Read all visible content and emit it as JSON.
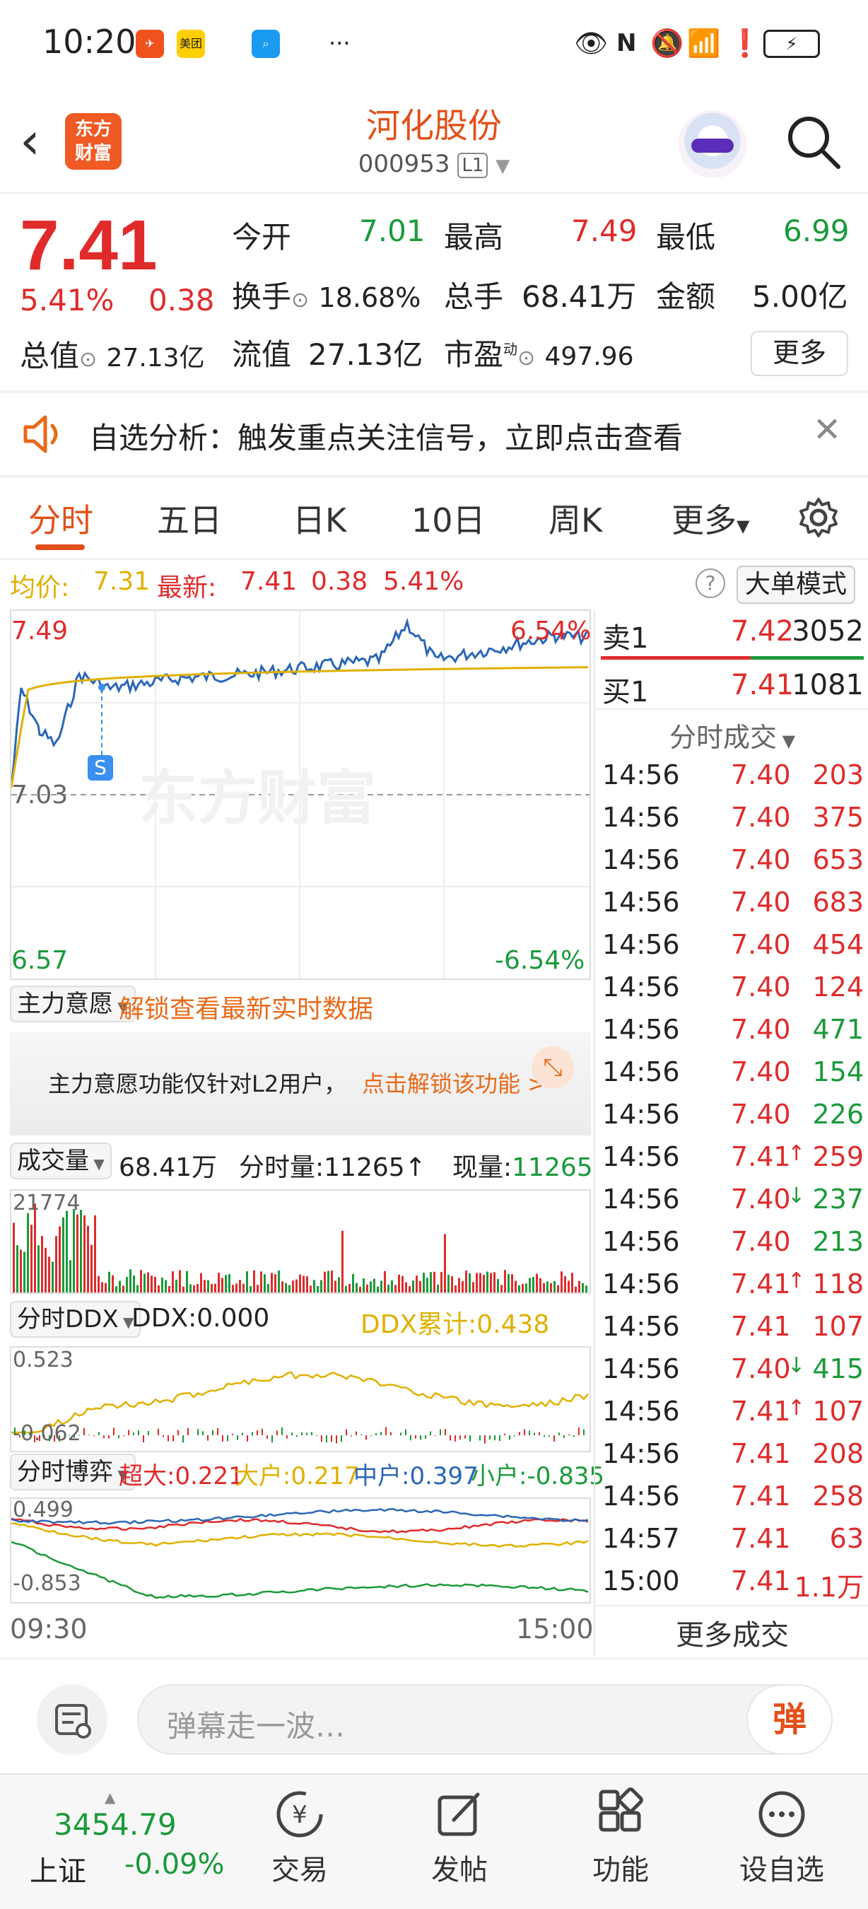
{
  "status_bar": {
    "time": "10:20",
    "app1": "",
    "app2": "美团",
    "dots": "···"
  },
  "header": {
    "logo_text": "东方\n财富",
    "stock_name": "河化股份",
    "stock_code": "000953",
    "level_badge": "L1"
  },
  "quote": {
    "price": "7.41",
    "change_pct": "5.41%",
    "change": "0.38",
    "open_label": "今开",
    "open": "7.01",
    "high_label": "最高",
    "high": "7.49",
    "low_label": "最低",
    "low": "6.99",
    "turnover_label": "换手",
    "turnover": "18.68%",
    "volume_label": "总手",
    "volume": "68.41万",
    "amount_label": "金额",
    "amount": "5.00亿",
    "mktcap_label": "总值",
    "mktcap": "27.13亿",
    "float_label": "流值",
    "float": "27.13亿",
    "pe_label": "市盈",
    "pe_sup": "动",
    "pe": "497.96",
    "more": "更多"
  },
  "notice": {
    "text": "自选分析：触发重点关注信号，立即点击查看"
  },
  "tabs": [
    {
      "label": "分时"
    },
    {
      "label": "五日"
    },
    {
      "label": "日K"
    },
    {
      "label": "10日"
    },
    {
      "label": "周K"
    },
    {
      "label": "更多"
    }
  ],
  "info_row": {
    "avg_label": "均价:",
    "avg": "7.31",
    "latest_label": "最新:",
    "latest": "7.41",
    "chg": "0.38",
    "pct": "5.41%",
    "big_order": "大单模式"
  },
  "price_chart": {
    "y_top": "7.49",
    "pct_top": "6.54%",
    "y_mid": "7.03",
    "y_bottom": "6.57",
    "pct_bottom": "-6.54%",
    "marker": "S",
    "watermark": "东方财富"
  },
  "main_force": {
    "dropdown": "主力意愿",
    "unlock": "解锁查看最新实时数据",
    "msg": "主力意愿功能仅针对L2用户，",
    "link": "点击解锁该功能 >"
  },
  "volume": {
    "dropdown": "成交量",
    "total": "68.41万",
    "tick_label": "分时量:",
    "tick_value": "11265↑",
    "now_label": "现量:",
    "now_value": "11265",
    "y_max": "21774"
  },
  "ddx": {
    "dropdown": "分时DDX",
    "ddx": "DDX:0.000",
    "cum": "DDX累计:0.438",
    "y_top": "0.523",
    "y_bottom": "-0.062"
  },
  "game": {
    "dropdown": "分时博弈",
    "super": "超大:0.221",
    "large": "大户:0.217",
    "mid": "中户:0.397",
    "small": "小户:-0.835",
    "y_top": "0.499",
    "y_bottom": "-0.853"
  },
  "time_axis": {
    "start": "09:30",
    "end": "15:00"
  },
  "order_book": [
    {
      "label": "卖1",
      "price": "7.42",
      "qty": "3052"
    },
    {
      "label": "买1",
      "price": "7.41",
      "qty": "1081"
    }
  ],
  "trades_title": "分时成交",
  "trades": [
    {
      "t": "14:56",
      "p": "7.40",
      "v": "203",
      "pc": "red",
      "vc": "red",
      "arrow": ""
    },
    {
      "t": "14:56",
      "p": "7.40",
      "v": "375",
      "pc": "red",
      "vc": "red",
      "arrow": ""
    },
    {
      "t": "14:56",
      "p": "7.40",
      "v": "653",
      "pc": "red",
      "vc": "red",
      "arrow": ""
    },
    {
      "t": "14:56",
      "p": "7.40",
      "v": "683",
      "pc": "red",
      "vc": "red",
      "arrow": ""
    },
    {
      "t": "14:56",
      "p": "7.40",
      "v": "454",
      "pc": "red",
      "vc": "red",
      "arrow": ""
    },
    {
      "t": "14:56",
      "p": "7.40",
      "v": "124",
      "pc": "red",
      "vc": "red",
      "arrow": ""
    },
    {
      "t": "14:56",
      "p": "7.40",
      "v": "471",
      "pc": "red",
      "vc": "green",
      "arrow": ""
    },
    {
      "t": "14:56",
      "p": "7.40",
      "v": "154",
      "pc": "red",
      "vc": "green",
      "arrow": ""
    },
    {
      "t": "14:56",
      "p": "7.40",
      "v": "226",
      "pc": "red",
      "vc": "green",
      "arrow": ""
    },
    {
      "t": "14:56",
      "p": "7.41",
      "v": "259",
      "pc": "red",
      "vc": "red",
      "arrow": "↑"
    },
    {
      "t": "14:56",
      "p": "7.40",
      "v": "237",
      "pc": "red",
      "vc": "green",
      "arrow": "↓"
    },
    {
      "t": "14:56",
      "p": "7.40",
      "v": "213",
      "pc": "red",
      "vc": "green",
      "arrow": ""
    },
    {
      "t": "14:56",
      "p": "7.41",
      "v": "118",
      "pc": "red",
      "vc": "red",
      "arrow": "↑"
    },
    {
      "t": "14:56",
      "p": "7.41",
      "v": "107",
      "pc": "red",
      "vc": "red",
      "arrow": ""
    },
    {
      "t": "14:56",
      "p": "7.40",
      "v": "415",
      "pc": "red",
      "vc": "green",
      "arrow": "↓"
    },
    {
      "t": "14:56",
      "p": "7.41",
      "v": "107",
      "pc": "red",
      "vc": "red",
      "arrow": "↑"
    },
    {
      "t": "14:56",
      "p": "7.41",
      "v": "208",
      "pc": "red",
      "vc": "red",
      "arrow": ""
    },
    {
      "t": "14:56",
      "p": "7.41",
      "v": "258",
      "pc": "red",
      "vc": "red",
      "arrow": ""
    },
    {
      "t": "14:57",
      "p": "7.41",
      "v": "63",
      "pc": "red",
      "vc": "red",
      "arrow": ""
    },
    {
      "t": "15:00",
      "p": "7.41",
      "v": "1.1万",
      "pc": "red",
      "vc": "red",
      "arrow": ""
    }
  ],
  "more_trades": "更多成交",
  "danmu": {
    "placeholder": "弹幕走一波…",
    "send": "弹"
  },
  "tabbar": {
    "index_value": "3454.79",
    "index_name": "上证",
    "index_change": "-0.09%",
    "items": [
      {
        "label": "交易"
      },
      {
        "label": "发帖"
      },
      {
        "label": "功能"
      },
      {
        "label": "设自选"
      }
    ]
  },
  "colors": {
    "red": "#e02b2b",
    "green": "#1a9a3a",
    "orange": "#e2501a",
    "gold": "#e0b000",
    "blue": "#2b66b8"
  }
}
